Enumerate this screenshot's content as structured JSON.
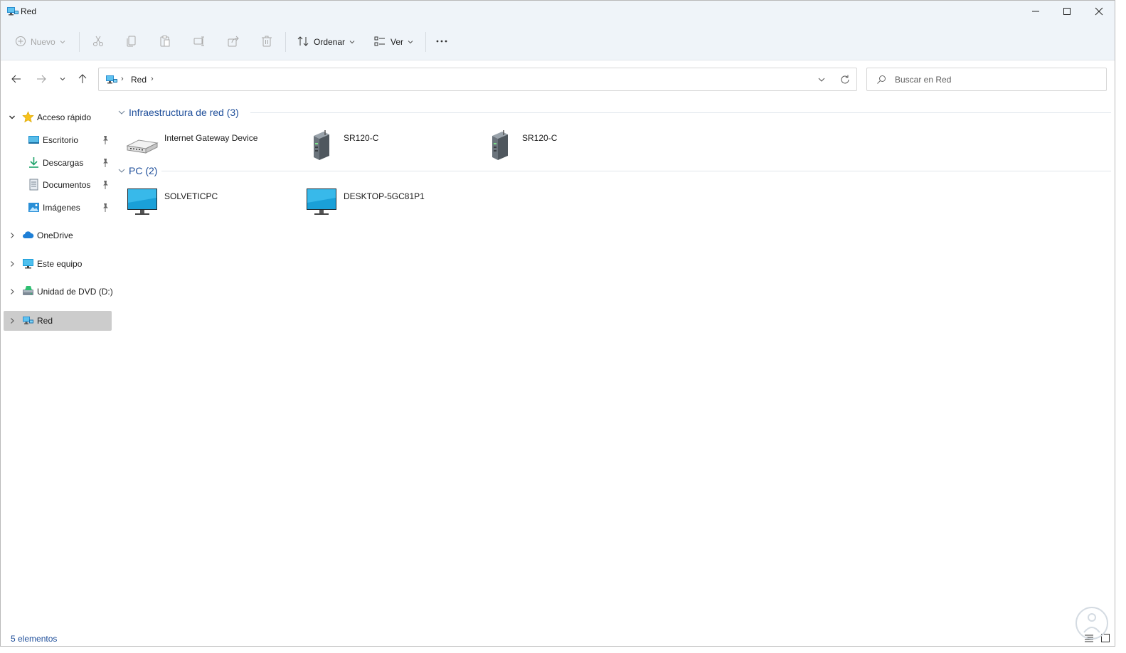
{
  "window": {
    "title": "Red"
  },
  "toolbar": {
    "nuevo_label": "Nuevo",
    "ordenar_label": "Ordenar",
    "ver_label": "Ver",
    "more_label": "···"
  },
  "address": {
    "crumb": "Red",
    "separator": "›"
  },
  "search": {
    "placeholder": "Buscar en Red"
  },
  "sidebar": {
    "items": [
      {
        "label": "Acceso rápido",
        "icon": "star-icon"
      },
      {
        "label": "Escritorio",
        "icon": "desktop-icon",
        "pinned": true
      },
      {
        "label": "Descargas",
        "icon": "download-icon",
        "pinned": true
      },
      {
        "label": "Documentos",
        "icon": "documents-icon",
        "pinned": true
      },
      {
        "label": "Imágenes",
        "icon": "pictures-icon",
        "pinned": true
      },
      {
        "label": "OneDrive",
        "icon": "cloud-icon"
      },
      {
        "label": "Este equipo",
        "icon": "computer-icon"
      },
      {
        "label": "Unidad de DVD (D:)",
        "icon": "dvd-drive-icon"
      },
      {
        "label": "Red",
        "icon": "network-icon",
        "selected": true
      }
    ]
  },
  "groups": [
    {
      "title": "Infraestructura de red (3)",
      "items": [
        {
          "label": "Internet Gateway Device",
          "icon": "router-icon"
        },
        {
          "label": "SR120-C",
          "icon": "server-tower-icon"
        },
        {
          "label": "SR120-C",
          "icon": "server-tower-icon"
        }
      ]
    },
    {
      "title": "PC (2)",
      "items": [
        {
          "label": "SOLVETICPC",
          "icon": "monitor-icon"
        },
        {
          "label": "DESKTOP-5GC81P1",
          "icon": "monitor-icon"
        }
      ]
    }
  ],
  "status": {
    "text": "5 elementos"
  },
  "colors": {
    "chrome_bg": "#eff4f9",
    "accent_text": "#1e4e9a",
    "selected_bg": "#cccccc",
    "monitor_screen": "#1aa0d8"
  }
}
